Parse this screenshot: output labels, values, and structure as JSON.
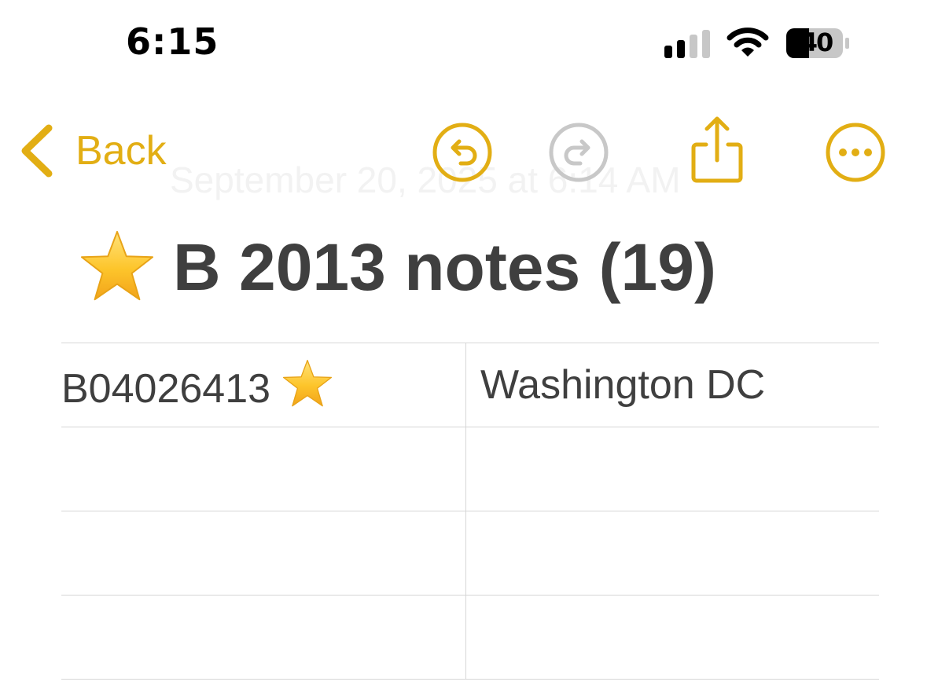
{
  "status_bar": {
    "time": "6:15",
    "battery": "40",
    "icons": [
      "signal-icon",
      "wifi-icon",
      "battery-icon"
    ]
  },
  "toolbar": {
    "back_label": "Back",
    "accent_color": "#E2AE14",
    "disabled_color": "#C8C8C8",
    "icons": [
      "chevron-left-icon",
      "undo-icon",
      "redo-icon",
      "share-icon",
      "more-icon"
    ]
  },
  "note": {
    "date": "September 20, 2025 at 6:14 AM",
    "title": "B 2013 notes (19)",
    "title_icon": "star-icon",
    "table": [
      [
        "B04026413",
        "Washington DC"
      ],
      [
        "",
        ""
      ],
      [
        "",
        ""
      ],
      [
        "",
        ""
      ]
    ]
  }
}
